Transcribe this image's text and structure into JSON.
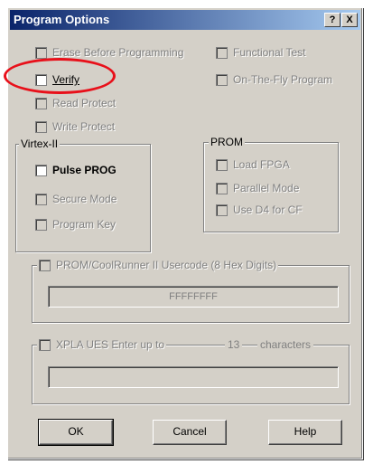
{
  "dialog": {
    "title": "Program Options",
    "help_btn": "?",
    "close_btn": "X"
  },
  "options": {
    "erase_before": "Erase Before Programming",
    "functional_test": "Functional Test",
    "verify": "Verify",
    "on_the_fly": "On-The-Fly Program",
    "read_protect": "Read Protect",
    "write_protect": "Write Protect"
  },
  "virtex": {
    "group_label": "Virtex-II",
    "pulse_prog": "Pulse PROG",
    "secure_mode": "Secure Mode",
    "program_key": "Program Key"
  },
  "prom": {
    "group_label": "PROM",
    "load_fpga": "Load FPGA",
    "parallel_mode": "Parallel Mode",
    "use_d4": "Use D4 for CF"
  },
  "usercode": {
    "label": "PROM/CoolRunner II Usercode (8 Hex Digits)",
    "value": "FFFFFFFF"
  },
  "xpla": {
    "label": "XPLA UES  Enter up to",
    "count": "13",
    "suffix": "characters",
    "value": ""
  },
  "buttons": {
    "ok": "OK",
    "cancel": "Cancel",
    "help": "Help"
  },
  "colors": {
    "annotation": "#e8101a",
    "title_bar": "#0a246a"
  }
}
